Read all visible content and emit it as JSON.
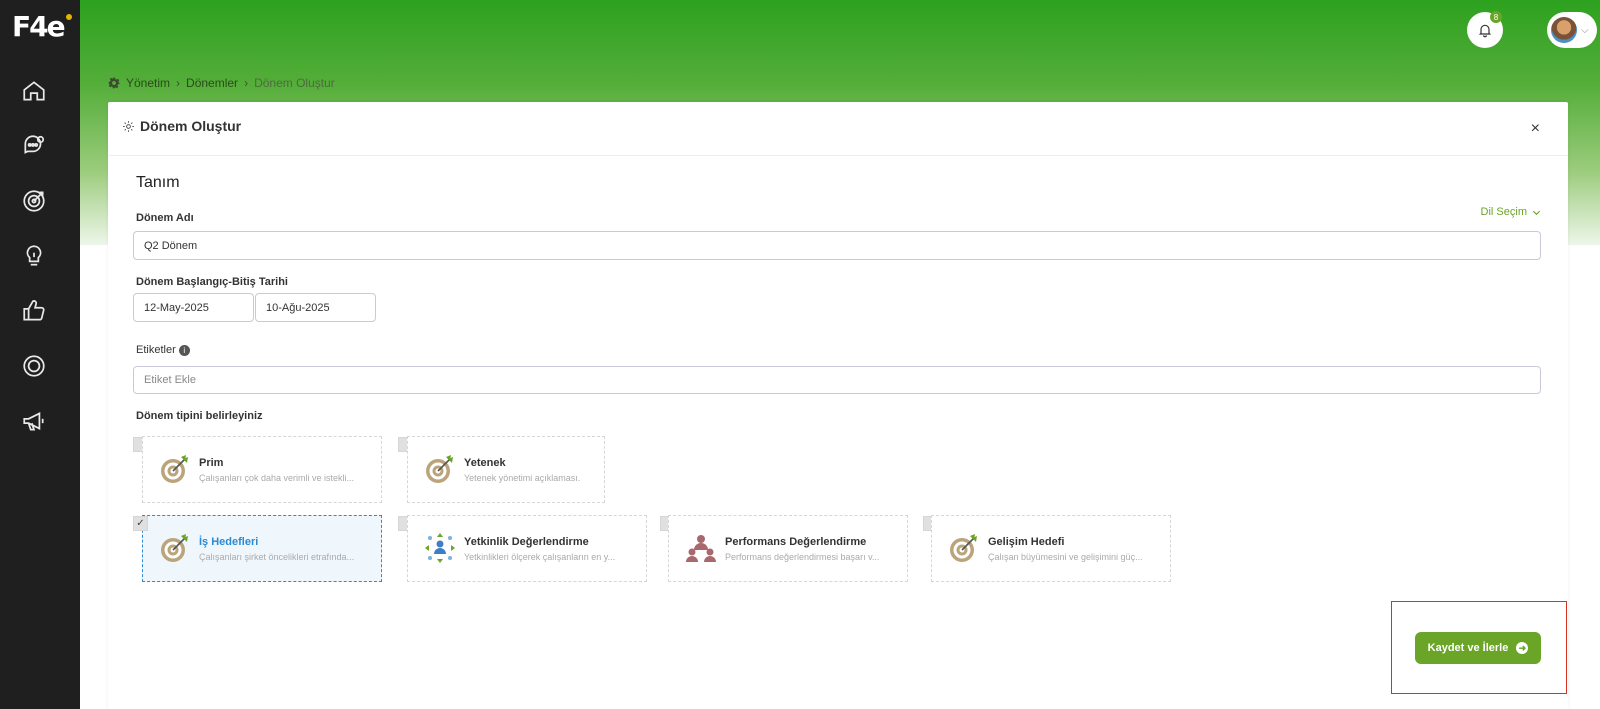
{
  "app": {
    "logo": "F4e"
  },
  "sidebar": {
    "items": [
      {
        "icon": "home-icon"
      },
      {
        "icon": "chat-gear-icon"
      },
      {
        "icon": "target-icon"
      },
      {
        "icon": "lightbulb-icon"
      },
      {
        "icon": "thumbs-up-icon"
      },
      {
        "icon": "circle-ring-icon"
      },
      {
        "icon": "megaphone-icon"
      }
    ]
  },
  "header": {
    "notification_count": "8"
  },
  "breadcrumb": {
    "items": [
      "Yönetim",
      "Dönemler",
      "Dönem Oluştur"
    ]
  },
  "card": {
    "title": "Dönem Oluştur",
    "close": "×"
  },
  "form": {
    "section_title": "Tanım",
    "name_label": "Dönem Adı",
    "language_select": "Dil Seçim",
    "name_value": "Q2 Dönem",
    "date_label": "Dönem Başlangıç-Bitiş Tarihi",
    "start_date": "12-May-2025",
    "end_date": "10-Ağu-2025",
    "tags_label": "Etiketler",
    "tags_placeholder": "Etiket Ekle",
    "type_label": "Dönem tipini belirleyiniz"
  },
  "types": [
    {
      "title": "Prim",
      "desc": "Çalışanları çok daha verimli ve istekli...",
      "checked": false
    },
    {
      "title": "Yetenek",
      "desc": "Yetenek yönetimi açıklaması.",
      "checked": false
    },
    {
      "title": "İş Hedefleri",
      "desc": "Çalışanları şirket öncelikleri etrafında...",
      "checked": true
    },
    {
      "title": "Yetkinlik Değerlendirme",
      "desc": "Yetkinlikleri ölçerek çalışanların en y...",
      "checked": false
    },
    {
      "title": "Performans Değerlendirme",
      "desc": "Performans değerlendirmesi başarı v...",
      "checked": false
    },
    {
      "title": "Gelişim Hedefi",
      "desc": "Çalışan büyümesini ve gelişimini güç...",
      "checked": false
    }
  ],
  "actions": {
    "save_label": "Kaydet ve İlerle"
  },
  "colors": {
    "accent": "#6aa528",
    "selected": "#2a8ad4",
    "sidebar": "#1f1f1f",
    "highlight": "#d93025"
  }
}
